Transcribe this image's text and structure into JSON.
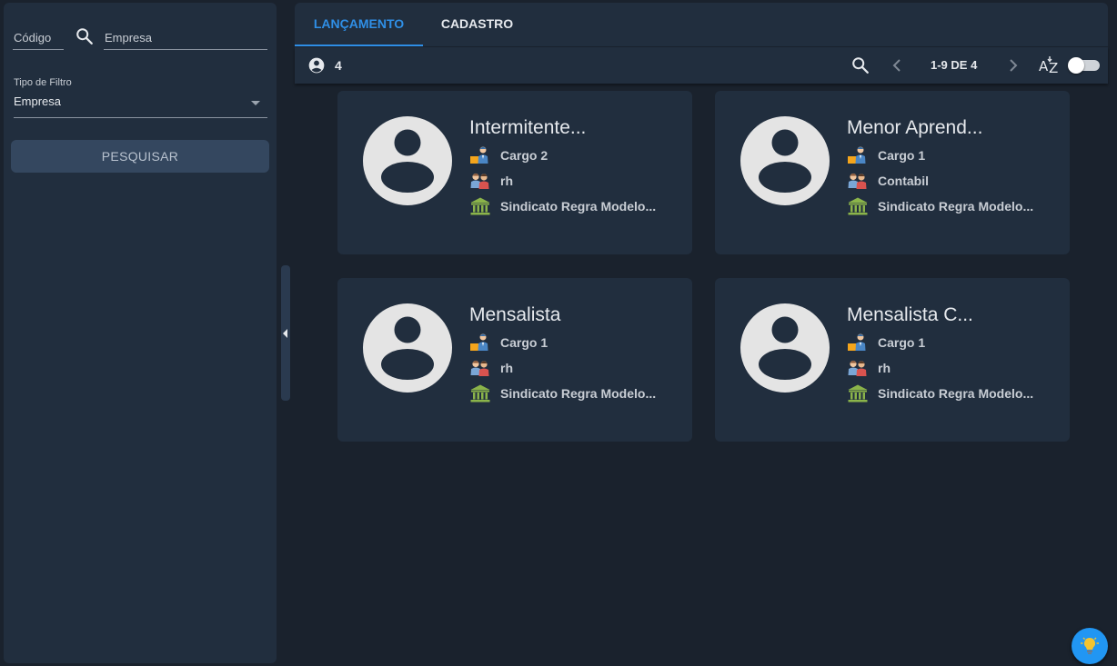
{
  "sidebar": {
    "codigo_placeholder": "Código",
    "empresa_placeholder": "Empresa",
    "tipo_filtro_label": "Tipo de Filtro",
    "tipo_filtro_value": "Empresa",
    "search_button": "PESQUISAR"
  },
  "tabs": [
    {
      "label": "LANÇAMENTO",
      "active": true
    },
    {
      "label": "CADASTRO",
      "active": false
    }
  ],
  "toolbar": {
    "count": "4",
    "pager": "1-9 DE 4",
    "sort_icon": "sort-az-icon",
    "toggle_on": false
  },
  "cards": [
    {
      "title": "Intermitente...",
      "cargo": "Cargo 2",
      "setor": "rh",
      "sindicato": "Sindicato Regra Modelo..."
    },
    {
      "title": "Menor Aprend...",
      "cargo": "Cargo 1",
      "setor": "Contabil",
      "sindicato": "Sindicato Regra Modelo..."
    },
    {
      "title": "Mensalista",
      "cargo": "Cargo 1",
      "setor": "rh",
      "sindicato": "Sindicato Regra Modelo..."
    },
    {
      "title": "Mensalista C...",
      "cargo": "Cargo 1",
      "setor": "rh",
      "sindicato": "Sindicato Regra Modelo..."
    }
  ],
  "colors": {
    "accent": "#2f8fe6",
    "panel": "#212e3e",
    "background": "#1a222d",
    "fab": "#2196f3"
  }
}
